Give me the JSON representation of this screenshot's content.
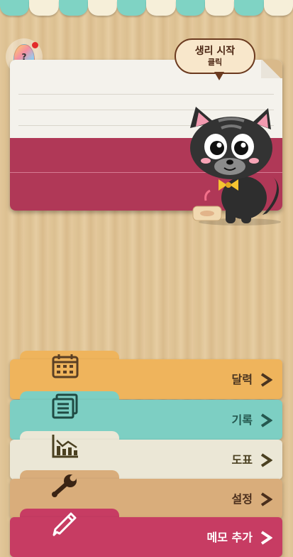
{
  "period_bubble": {
    "line1": "생리 시작",
    "line2": "클릭"
  },
  "help_button": {
    "glyph": "?"
  },
  "menu": [
    {
      "label": "달력",
      "icon": "calendar-icon",
      "color": "#efb45c"
    },
    {
      "label": "기록",
      "icon": "list-icon",
      "color": "#7dcfc3"
    },
    {
      "label": "도표",
      "icon": "chart-icon",
      "color": "#ebe7d6"
    },
    {
      "label": "설정",
      "icon": "wrench-icon",
      "color": "#d9ad7b"
    },
    {
      "label": "메모 추가",
      "icon": "pencil-icon",
      "color": "#c73c63"
    }
  ]
}
